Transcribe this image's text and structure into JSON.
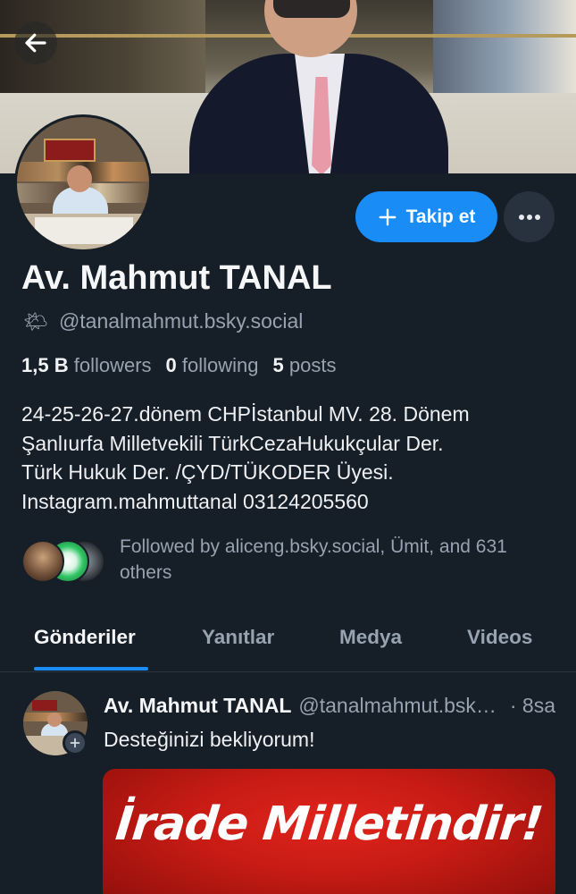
{
  "profile": {
    "display_name": "Av. Mahmut TANAL",
    "handle_emoji": "🌤",
    "handle": "@tanalmahmut.bsky.social",
    "stats": {
      "followers_count": "1,5 B",
      "followers_label": "followers",
      "following_count": "0",
      "following_label": "following",
      "posts_count": "5",
      "posts_label": "posts"
    },
    "bio": [
      "24-25-26-27.dönem CHPİstanbul MV. 28. Dönem",
      "Şanlıurfa Milletvekili TürkCezaHukukçular Der.",
      "Türk Hukuk Der. /ÇYD/TÜKODER Üyesi.",
      "Instagram.mahmuttanal 03124205560"
    ],
    "followed_by": "Followed by aliceng.bsky.social, Ümit, and 631 others"
  },
  "actions": {
    "follow_label": "Takip et",
    "accent_color": "#1a8cf5"
  },
  "tabs": [
    {
      "label": "Gönderiler",
      "active": true
    },
    {
      "label": "Yanıtlar",
      "active": false
    },
    {
      "label": "Medya",
      "active": false
    },
    {
      "label": "Videos",
      "active": false
    }
  ],
  "post": {
    "author": "Av. Mahmut TANAL",
    "handle": "@tanalmahmut.bsky.social",
    "time": "· 8sa",
    "text": "Desteğinizi bekliyorum!",
    "image_text": "İrade Milletindir!"
  },
  "icons": {
    "back": "arrow-left-icon",
    "follow": "plus-icon",
    "more": "ellipsis-icon",
    "post_avatar_badge": "plus-icon"
  }
}
